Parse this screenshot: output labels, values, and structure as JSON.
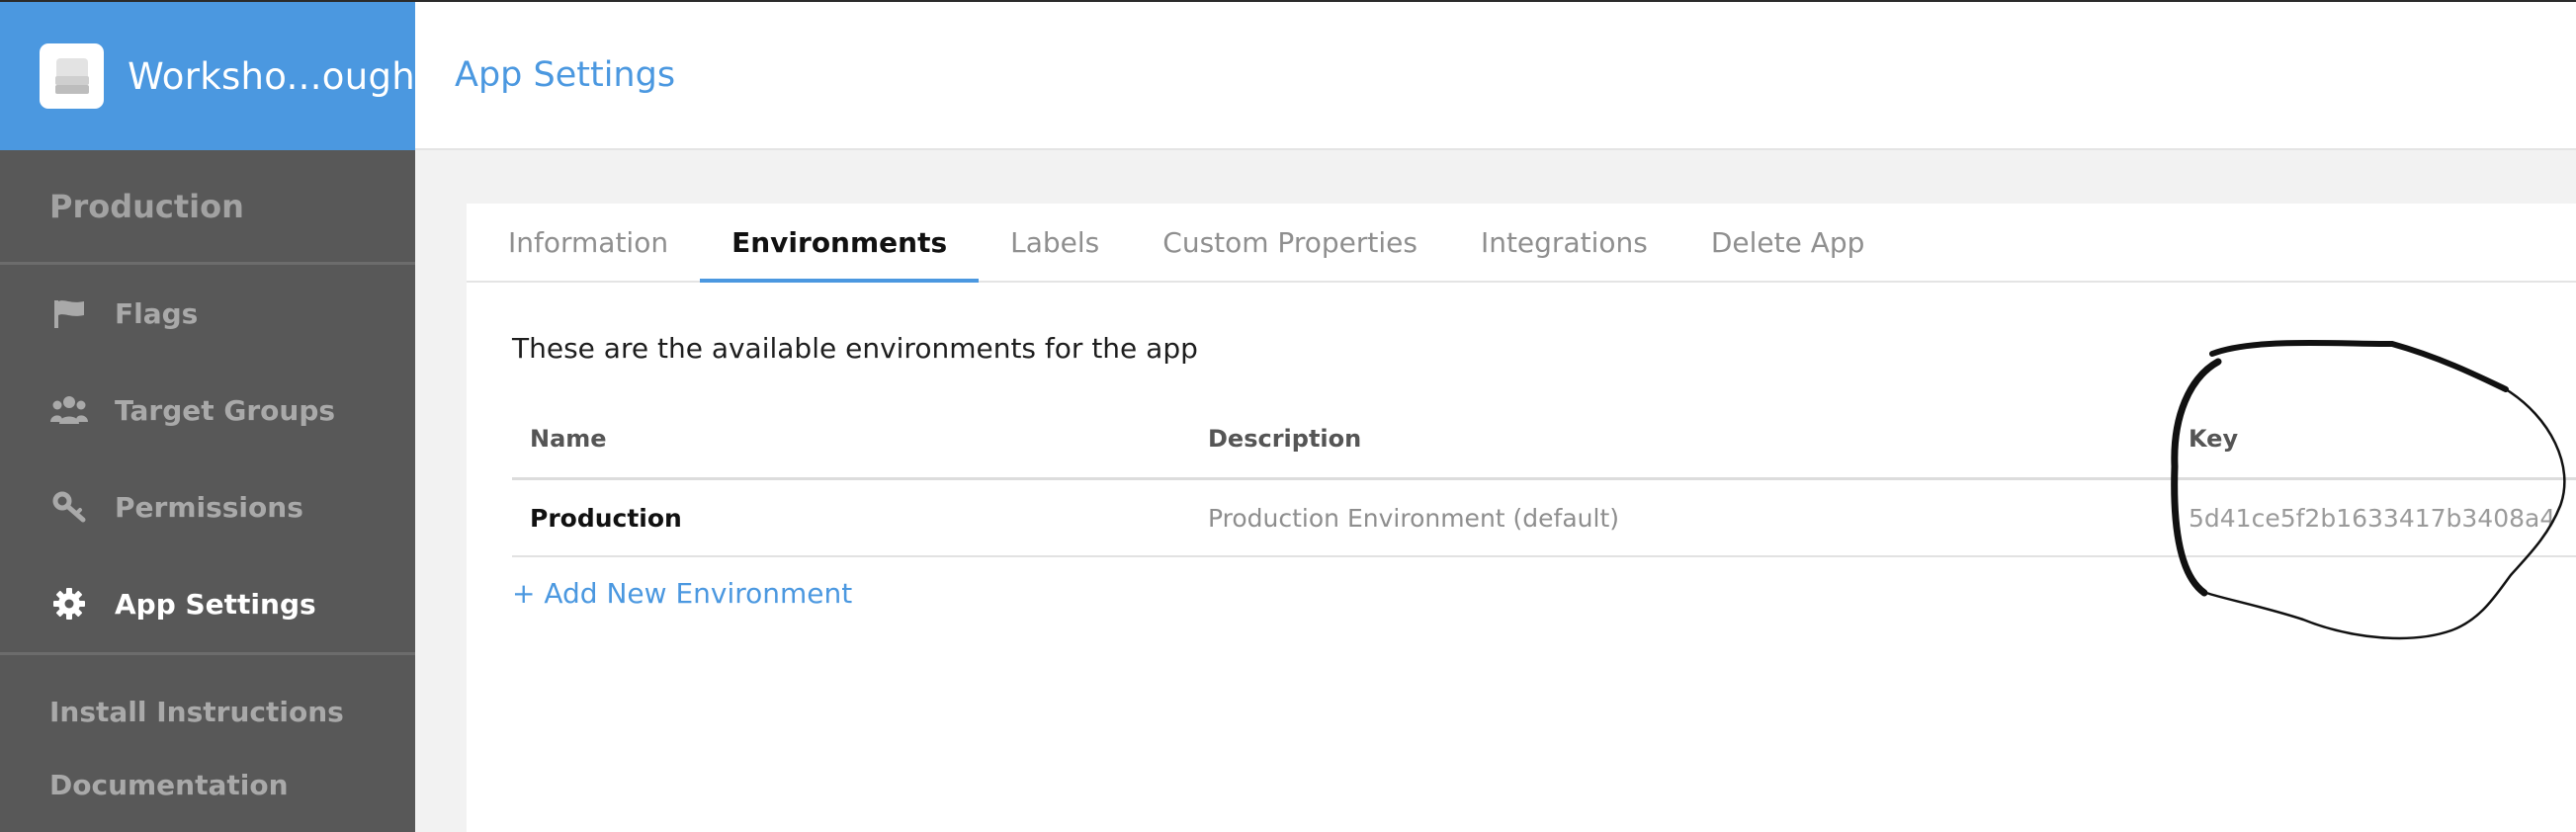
{
  "app": {
    "name": "Worksho...ough"
  },
  "sidebar": {
    "environment": "Production",
    "items": [
      {
        "label": "Flags",
        "icon": "flag-icon",
        "active": false
      },
      {
        "label": "Target Groups",
        "icon": "users-icon",
        "active": false
      },
      {
        "label": "Permissions",
        "icon": "key-icon",
        "active": false
      },
      {
        "label": "App Settings",
        "icon": "gear-icon",
        "active": true
      }
    ],
    "links": [
      {
        "label": "Install Instructions"
      },
      {
        "label": "Documentation"
      }
    ]
  },
  "header": {
    "title": "App Settings"
  },
  "tabs": [
    {
      "label": "Information"
    },
    {
      "label": "Environments",
      "active": true
    },
    {
      "label": "Labels"
    },
    {
      "label": "Custom Properties"
    },
    {
      "label": "Integrations"
    },
    {
      "label": "Delete App"
    }
  ],
  "environments": {
    "intro": "These are the available environments for the app",
    "columns": {
      "name": "Name",
      "description": "Description",
      "key": "Key"
    },
    "rows": [
      {
        "name": "Production",
        "description": "Production Environment (default)",
        "key": "5d41ce5f2b1633417b3408a4"
      }
    ],
    "add_label": "+ Add New Environment"
  },
  "colors": {
    "accent": "#4b98e0",
    "sidebar": "#585858",
    "annotation": "#111111"
  }
}
